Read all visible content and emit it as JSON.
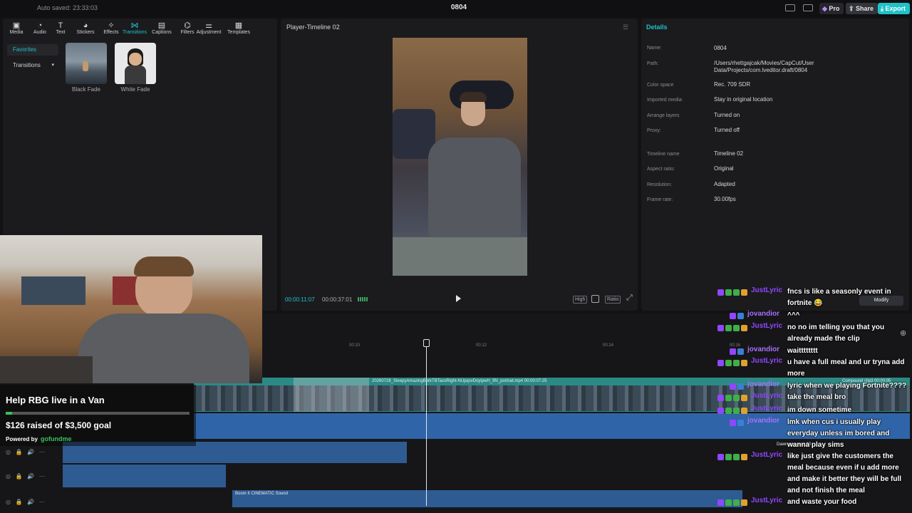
{
  "app": {
    "autosave": "Auto saved: 23:33:03",
    "project_title": "0804",
    "pro_label": "Pro",
    "share_label": "Share",
    "export_label": "Export"
  },
  "toolbar": {
    "tabs": [
      {
        "label": "Media",
        "icon": "media-icon"
      },
      {
        "label": "Audio",
        "icon": "audio-icon"
      },
      {
        "label": "Text",
        "icon": "text-icon"
      },
      {
        "label": "Stickers",
        "icon": "stickers-icon"
      },
      {
        "label": "Effects",
        "icon": "effects-icon"
      },
      {
        "label": "Transitions",
        "icon": "transitions-icon",
        "active": true
      },
      {
        "label": "Captions",
        "icon": "captions-icon"
      },
      {
        "label": "Filters",
        "icon": "filters-icon"
      },
      {
        "label": "Adjustment",
        "icon": "adjustment-icon"
      },
      {
        "label": "Templates",
        "icon": "templates-icon"
      }
    ]
  },
  "library": {
    "favorites": "Favorites",
    "transitions": "Transitions",
    "items": [
      {
        "label": "Black Fade"
      },
      {
        "label": "White Fade"
      }
    ]
  },
  "player": {
    "title": "Player-Timeline 02",
    "current_time": "00:00:11:07",
    "total_time": "00:00:37:01",
    "quality": "High",
    "ratio": "Ratio"
  },
  "details": {
    "title": "Details",
    "rows": [
      {
        "label": "Name:",
        "value": "0804"
      },
      {
        "label": "Path:",
        "value": "/Users/rhettgajcak/Movies/CapCut/User Data/Projects/com.lveditor.draft/0804"
      },
      {
        "label": "Color space",
        "value": "Rec. 709 SDR"
      },
      {
        "label": "Imported media:",
        "value": "Stay in original location"
      },
      {
        "label": "Arrange layers",
        "value": "Turned on"
      },
      {
        "label": "Proxy:",
        "value": "Turned off"
      },
      {
        "label": "Timeline name",
        "value": "Timeline 02"
      },
      {
        "label": "Aspect ratio:",
        "value": "Original"
      },
      {
        "label": "Resolution:",
        "value": "Adapted"
      },
      {
        "label": "Frame rate:",
        "value": "30.00fps"
      }
    ],
    "modify": "Modify"
  },
  "timeline": {
    "ruler": [
      "00:10",
      "00:12",
      "00:14",
      "00:16"
    ],
    "main_clip": "20260728_SleepyAmazingBorkTBTacoRight-NUpqsvDoyipwH_9N_portrait.mp4  00:00:07:25",
    "compound_clip": "Compound clip3  00:00:05",
    "audio_clip": "Boom II CINEMATIC Sound",
    "audio_clip2": "Dawn compact 03"
  },
  "gofundme": {
    "title": "Help RBG live in a Van",
    "raised": "$126 raised of $3,500 goal",
    "progress_fraction": 0.036,
    "powered_by": "Powered by",
    "logo": "gofundme"
  },
  "chat": [
    {
      "user": "JustLyric",
      "color": "#9146ff",
      "badges": 4,
      "lines": [
        "fncs is like a seasonly event in",
        "fortnite 😂"
      ]
    },
    {
      "user": "jovandior",
      "color": "#a970ff",
      "badges": 2,
      "lines": [
        "^^^"
      ]
    },
    {
      "user": "JustLyric",
      "color": "#9146ff",
      "badges": 4,
      "lines": [
        "no no im telling you that you",
        "already made the clip"
      ]
    },
    {
      "user": "jovandior",
      "color": "#a970ff",
      "badges": 2,
      "lines": [
        "waitttttttt"
      ]
    },
    {
      "user": "JustLyric",
      "color": "#9146ff",
      "badges": 4,
      "lines": [
        "u have a full meal and ur tryna add",
        "more"
      ]
    },
    {
      "user": "jovandior",
      "color": "#a970ff",
      "badges": 2,
      "lines": [
        "lyric when we playing Fortnite????"
      ]
    },
    {
      "user": "JustLyric",
      "color": "#9146ff",
      "badges": 4,
      "lines": [
        "take the meal bro"
      ]
    },
    {
      "user": "JustLyric",
      "color": "#9146ff",
      "badges": 4,
      "lines": [
        "im down sometime"
      ]
    },
    {
      "user": "jovandior",
      "color": "#a970ff",
      "badges": 2,
      "lines": [
        "lmk when cus i usually play",
        "everyday unless im bored and",
        "wanna play sims"
      ]
    },
    {
      "user": "JustLyric",
      "color": "#9146ff",
      "badges": 4,
      "lines": [
        "like just give the customers the",
        "meal because even if u add more",
        "and make it better they will be full",
        "and not finish the meal"
      ]
    },
    {
      "user": "JustLyric",
      "color": "#9146ff",
      "badges": 4,
      "lines": [
        "and waste your food"
      ]
    }
  ]
}
